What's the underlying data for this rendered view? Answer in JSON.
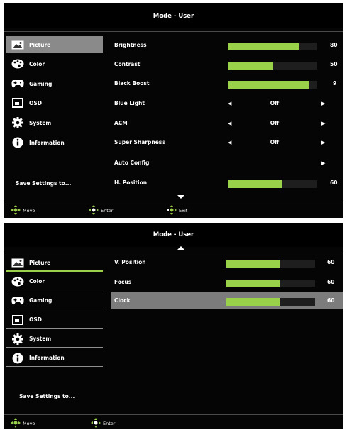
{
  "screen1": {
    "title": "Mode - User",
    "sidebar": [
      {
        "label": "Picture",
        "icon": "picture-icon"
      },
      {
        "label": "Color",
        "icon": "palette-icon"
      },
      {
        "label": "Gaming",
        "icon": "gamepad-icon"
      },
      {
        "label": "OSD",
        "icon": "osd-icon"
      },
      {
        "label": "System",
        "icon": "gear-icon"
      },
      {
        "label": "Information",
        "icon": "info-icon"
      }
    ],
    "save_label": "Save Settings to...",
    "rows": {
      "brightness": {
        "label": "Brightness",
        "value": "80",
        "level": 0.8
      },
      "contrast": {
        "label": "Contrast",
        "value": "50",
        "level": 0.5
      },
      "black_boost": {
        "label": "Black Boost",
        "value": "9",
        "level": 0.9
      },
      "blue_light": {
        "label": "Blue Light",
        "option": "Off"
      },
      "acm": {
        "label": "ACM",
        "option": "Off"
      },
      "super_sharpness": {
        "label": "Super Sharpness",
        "option": "Off"
      },
      "auto_config": {
        "label": "Auto Config"
      },
      "h_position": {
        "label": "H. Position",
        "value": "60",
        "level": 0.6
      }
    },
    "footer": {
      "move": "Move",
      "enter": "Enter",
      "exit": "Exit"
    }
  },
  "screen2": {
    "title": "Mode - User",
    "sidebar": [
      {
        "label": "Picture",
        "icon": "picture-icon"
      },
      {
        "label": "Color",
        "icon": "palette-icon"
      },
      {
        "label": "Gaming",
        "icon": "gamepad-icon"
      },
      {
        "label": "OSD",
        "icon": "osd-icon"
      },
      {
        "label": "System",
        "icon": "gear-icon"
      },
      {
        "label": "Information",
        "icon": "info-icon"
      }
    ],
    "save_label": "Save Settings to...",
    "rows": {
      "v_position": {
        "label": "V. Position",
        "value": "60",
        "level": 0.6
      },
      "focus": {
        "label": "Focus",
        "value": "60",
        "level": 0.6
      },
      "clock": {
        "label": "Clock",
        "value": "60",
        "level": 0.6
      }
    },
    "footer": {
      "move": "Move",
      "enter": "Enter"
    }
  },
  "colors": {
    "accent": "#9ad14b",
    "selected_bg": "#8a8a8a",
    "highlight_row": "#7c7c7c",
    "panel_bg": "#050505"
  }
}
